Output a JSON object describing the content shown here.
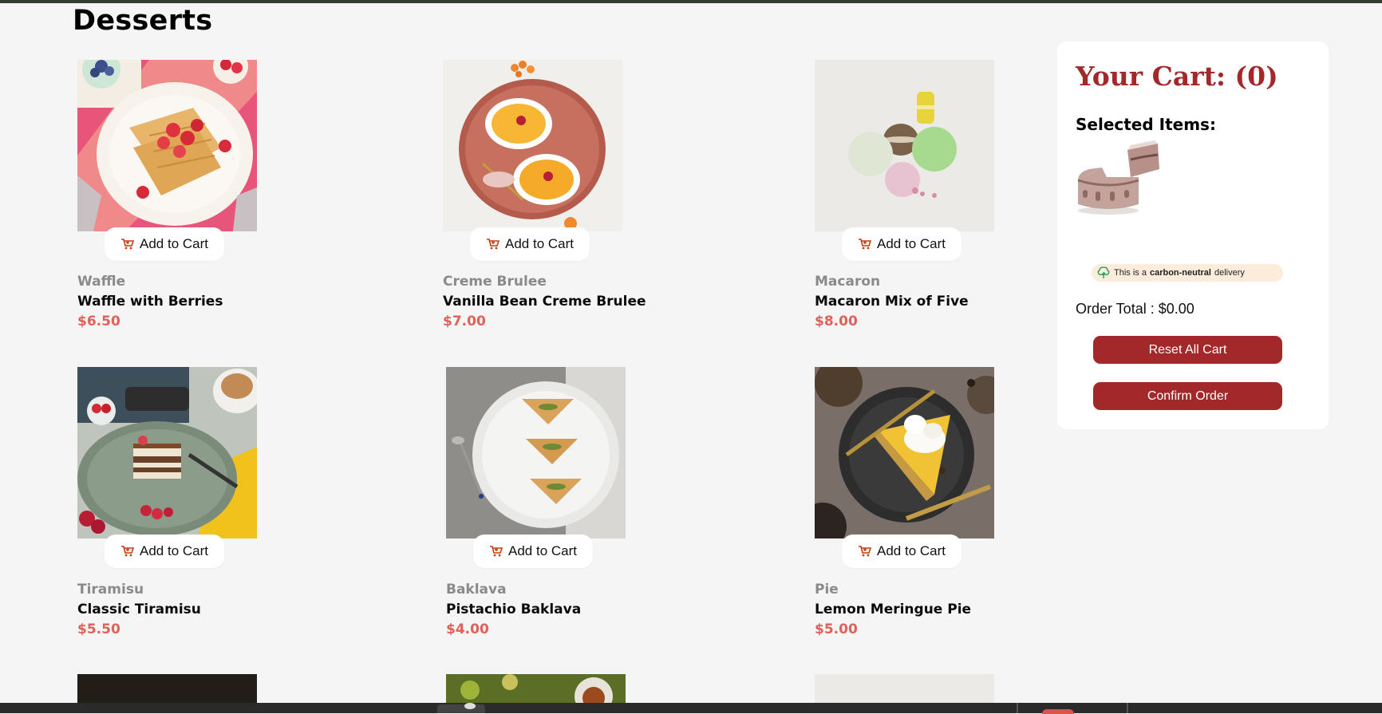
{
  "page": {
    "title": "Desserts"
  },
  "icons": {
    "cart": "cart-icon",
    "tree": "tree-icon",
    "cake": "cake-icon"
  },
  "colors": {
    "accent": "#a3282a",
    "price": "#e0605a",
    "category": "#8a8a8a",
    "background": "#f5f5f5"
  },
  "products": [
    {
      "category": "Waffle",
      "name": "Waffle with Berries",
      "price": "$6.50",
      "add_label": "Add to Cart"
    },
    {
      "category": "Creme Brulee",
      "name": "Vanilla Bean Creme Brulee",
      "price": "$7.00",
      "add_label": "Add to Cart"
    },
    {
      "category": "Macaron",
      "name": "Macaron Mix of Five",
      "price": "$8.00",
      "add_label": "Add to Cart"
    },
    {
      "category": "Tiramisu",
      "name": "Classic Tiramisu",
      "price": "$5.50",
      "add_label": "Add to Cart"
    },
    {
      "category": "Baklava",
      "name": "Pistachio Baklava",
      "price": "$4.00",
      "add_label": "Add to Cart"
    },
    {
      "category": "Pie",
      "name": "Lemon Meringue Pie",
      "price": "$5.00",
      "add_label": "Add to Cart"
    }
  ],
  "cart": {
    "title": "Your Cart: (0)",
    "selected_heading": "Selected Items:",
    "carbon_prefix": "This is a",
    "carbon_bold": "carbon-neutral",
    "carbon_suffix": "delivery",
    "order_total": "Order Total : $0.00",
    "reset_label": "Reset All Cart",
    "confirm_label": "Confirm Order"
  }
}
